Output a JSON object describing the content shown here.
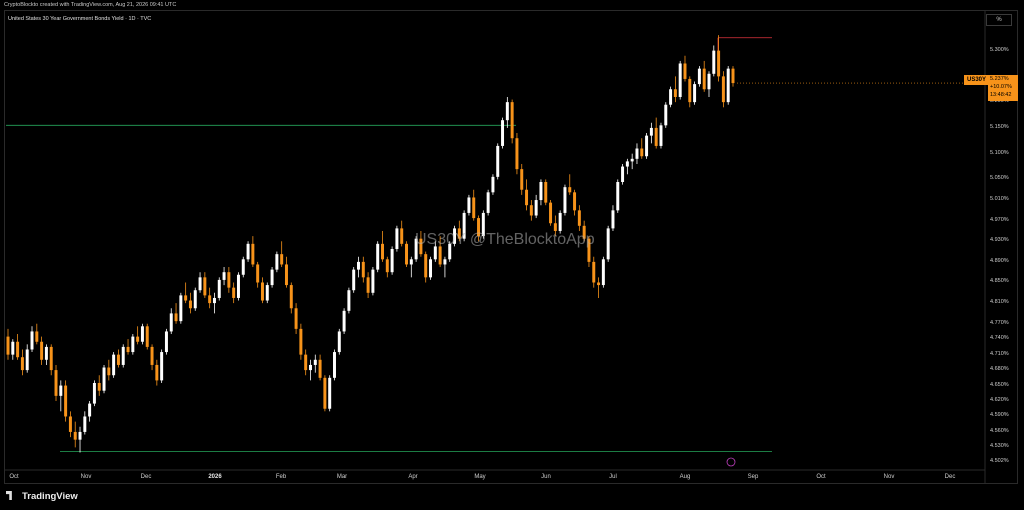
{
  "header": {
    "credit": "CryptoBlockto created with TradingView.com, Aug 21, 2026 09:41 UTC",
    "title": "United States 30 Year Government Bonds Yield · 1D · TVC",
    "scale_button": "%"
  },
  "watermark": "US30Y @TheBlocktoApp",
  "footer": {
    "brand": "TradingView"
  },
  "current": {
    "symbol": "US30Y",
    "price": "5.237%",
    "change": "+10.07%",
    "countdown": "13:48:42"
  },
  "colors": {
    "background": "#000000",
    "up": "#ffffff",
    "down": "#f7931a",
    "resistance": "#e0333c",
    "support": "#26a65b",
    "accent": "#f7931a"
  },
  "chart_data": {
    "type": "candlestick",
    "title": "United States 30 Year Government Bonds Yield · 1D · TVC",
    "y_axis": {
      "ticks": [
        "5.300%",
        "5.250%",
        "5.200%",
        "5.150%",
        "5.100%",
        "5.050%",
        "5.010%",
        "4.970%",
        "4.930%",
        "4.890%",
        "4.850%",
        "4.810%",
        "4.770%",
        "4.740%",
        "4.710%",
        "4.680%",
        "4.650%",
        "4.620%",
        "4.590%",
        "4.560%",
        "4.530%",
        "4.502%"
      ],
      "range": [
        4.49,
        5.34
      ]
    },
    "x_axis": {
      "ticks": [
        "Oct",
        "Nov",
        "Dec",
        "2026",
        "Feb",
        "Mar",
        "Apr",
        "May",
        "Jun",
        "Jul",
        "Aug",
        "Sep",
        "Oct",
        "Nov",
        "Dec"
      ],
      "bold": [
        "2026"
      ]
    },
    "levels": [
      {
        "price": 5.155,
        "color": "support"
      },
      {
        "price": 4.522,
        "color": "support"
      },
      {
        "price": 5.325,
        "color": "resistance"
      }
    ],
    "candles_ohlc": [
      [
        4.745,
        4.76,
        4.7,
        4.71
      ],
      [
        4.71,
        4.74,
        4.7,
        4.735
      ],
      [
        4.735,
        4.75,
        4.7,
        4.705
      ],
      [
        4.705,
        4.72,
        4.67,
        4.68
      ],
      [
        4.68,
        4.73,
        4.675,
        4.72
      ],
      [
        4.72,
        4.765,
        4.715,
        4.755
      ],
      [
        4.755,
        4.77,
        4.73,
        4.735
      ],
      [
        4.735,
        4.745,
        4.69,
        4.7
      ],
      [
        4.7,
        4.73,
        4.69,
        4.725
      ],
      [
        4.725,
        4.73,
        4.67,
        4.68
      ],
      [
        4.68,
        4.69,
        4.62,
        4.63
      ],
      [
        4.63,
        4.66,
        4.6,
        4.65
      ],
      [
        4.65,
        4.66,
        4.58,
        4.59
      ],
      [
        4.59,
        4.6,
        4.55,
        4.56
      ],
      [
        4.56,
        4.58,
        4.53,
        4.545
      ],
      [
        4.545,
        4.57,
        4.52,
        4.56
      ],
      [
        4.56,
        4.6,
        4.555,
        4.59
      ],
      [
        4.59,
        4.62,
        4.58,
        4.615
      ],
      [
        4.615,
        4.66,
        4.61,
        4.655
      ],
      [
        4.655,
        4.67,
        4.63,
        4.64
      ],
      [
        4.64,
        4.69,
        4.635,
        4.685
      ],
      [
        4.685,
        4.7,
        4.66,
        4.67
      ],
      [
        4.67,
        4.715,
        4.665,
        4.71
      ],
      [
        4.71,
        4.72,
        4.685,
        4.69
      ],
      [
        4.69,
        4.73,
        4.685,
        4.725
      ],
      [
        4.725,
        4.74,
        4.71,
        4.715
      ],
      [
        4.715,
        4.75,
        4.71,
        4.745
      ],
      [
        4.745,
        4.765,
        4.73,
        4.735
      ],
      [
        4.735,
        4.77,
        4.73,
        4.765
      ],
      [
        4.765,
        4.77,
        4.72,
        4.725
      ],
      [
        4.725,
        4.73,
        4.68,
        4.69
      ],
      [
        4.69,
        4.7,
        4.65,
        4.66
      ],
      [
        4.66,
        4.72,
        4.655,
        4.715
      ],
      [
        4.715,
        4.76,
        4.71,
        4.755
      ],
      [
        4.755,
        4.8,
        4.75,
        4.79
      ],
      [
        4.79,
        4.81,
        4.77,
        4.775
      ],
      [
        4.775,
        4.83,
        4.77,
        4.825
      ],
      [
        4.825,
        4.85,
        4.81,
        4.815
      ],
      [
        4.815,
        4.83,
        4.79,
        4.8
      ],
      [
        4.8,
        4.84,
        4.795,
        4.835
      ],
      [
        4.835,
        4.87,
        4.83,
        4.86
      ],
      [
        4.86,
        4.87,
        4.82,
        4.825
      ],
      [
        4.825,
        4.84,
        4.8,
        4.81
      ],
      [
        4.81,
        4.83,
        4.79,
        4.82
      ],
      [
        4.82,
        4.86,
        4.815,
        4.855
      ],
      [
        4.855,
        4.88,
        4.845,
        4.87
      ],
      [
        4.87,
        4.88,
        4.83,
        4.84
      ],
      [
        4.84,
        4.85,
        4.81,
        4.82
      ],
      [
        4.82,
        4.87,
        4.815,
        4.865
      ],
      [
        4.865,
        4.9,
        4.86,
        4.895
      ],
      [
        4.895,
        4.93,
        4.89,
        4.925
      ],
      [
        4.925,
        4.94,
        4.88,
        4.885
      ],
      [
        4.885,
        4.89,
        4.84,
        4.85
      ],
      [
        4.85,
        4.86,
        4.81,
        4.815
      ],
      [
        4.815,
        4.85,
        4.81,
        4.845
      ],
      [
        4.845,
        4.88,
        4.84,
        4.875
      ],
      [
        4.875,
        4.91,
        4.87,
        4.905
      ],
      [
        4.905,
        4.93,
        4.88,
        4.885
      ],
      [
        4.885,
        4.9,
        4.84,
        4.845
      ],
      [
        4.845,
        4.85,
        4.79,
        4.8
      ],
      [
        4.8,
        4.81,
        4.75,
        4.76
      ],
      [
        4.76,
        4.77,
        4.7,
        4.71
      ],
      [
        4.71,
        4.72,
        4.67,
        4.68
      ],
      [
        4.68,
        4.7,
        4.66,
        4.69
      ],
      [
        4.69,
        4.71,
        4.675,
        4.7
      ],
      [
        4.7,
        4.71,
        4.66,
        4.665
      ],
      [
        4.665,
        4.67,
        4.6,
        4.605
      ],
      [
        4.605,
        4.67,
        4.6,
        4.665
      ],
      [
        4.665,
        4.72,
        4.66,
        4.715
      ],
      [
        4.715,
        4.76,
        4.71,
        4.755
      ],
      [
        4.755,
        4.8,
        4.75,
        4.795
      ],
      [
        4.795,
        4.84,
        4.79,
        4.835
      ],
      [
        4.835,
        4.88,
        4.83,
        4.875
      ],
      [
        4.875,
        4.9,
        4.86,
        4.89
      ],
      [
        4.89,
        4.9,
        4.85,
        4.86
      ],
      [
        4.86,
        4.87,
        4.82,
        4.83
      ],
      [
        4.83,
        4.88,
        4.825,
        4.875
      ],
      [
        4.875,
        4.93,
        4.87,
        4.925
      ],
      [
        4.925,
        4.95,
        4.89,
        4.895
      ],
      [
        4.895,
        4.9,
        4.86,
        4.87
      ],
      [
        4.87,
        4.92,
        4.865,
        4.915
      ],
      [
        4.915,
        4.96,
        4.91,
        4.955
      ],
      [
        4.955,
        4.97,
        4.92,
        4.925
      ],
      [
        4.925,
        4.93,
        4.88,
        4.885
      ],
      [
        4.885,
        4.9,
        4.86,
        4.895
      ],
      [
        4.895,
        4.94,
        4.89,
        4.935
      ],
      [
        4.935,
        4.95,
        4.9,
        4.905
      ],
      [
        4.905,
        4.91,
        4.85,
        4.86
      ],
      [
        4.86,
        4.9,
        4.855,
        4.895
      ],
      [
        4.895,
        4.93,
        4.89,
        4.92
      ],
      [
        4.92,
        4.94,
        4.88,
        4.885
      ],
      [
        4.885,
        4.9,
        4.86,
        4.895
      ],
      [
        4.895,
        4.93,
        4.89,
        4.925
      ],
      [
        4.925,
        4.96,
        4.92,
        4.955
      ],
      [
        4.955,
        4.97,
        4.93,
        4.935
      ],
      [
        4.935,
        4.99,
        4.93,
        4.985
      ],
      [
        4.985,
        5.02,
        4.98,
        5.015
      ],
      [
        5.015,
        5.03,
        4.97,
        4.975
      ],
      [
        4.975,
        4.98,
        4.93,
        4.94
      ],
      [
        4.94,
        4.99,
        4.935,
        4.985
      ],
      [
        4.985,
        5.03,
        4.98,
        5.025
      ],
      [
        5.025,
        5.06,
        5.02,
        5.055
      ],
      [
        5.055,
        5.12,
        5.05,
        5.115
      ],
      [
        5.115,
        5.17,
        5.11,
        5.165
      ],
      [
        5.165,
        5.21,
        5.15,
        5.2
      ],
      [
        5.2,
        5.205,
        5.12,
        5.13
      ],
      [
        5.13,
        5.14,
        5.06,
        5.07
      ],
      [
        5.07,
        5.08,
        5.02,
        5.03
      ],
      [
        5.03,
        5.05,
        4.99,
        5.0
      ],
      [
        5.0,
        5.01,
        4.97,
        4.98
      ],
      [
        4.98,
        5.02,
        4.975,
        5.01
      ],
      [
        5.01,
        5.05,
        5.0,
        5.045
      ],
      [
        5.045,
        5.05,
        5.0,
        5.005
      ],
      [
        5.005,
        5.01,
        4.96,
        4.965
      ],
      [
        4.965,
        4.98,
        4.94,
        4.95
      ],
      [
        4.95,
        4.99,
        4.945,
        4.985
      ],
      [
        4.985,
        5.04,
        4.98,
        5.035
      ],
      [
        5.035,
        5.06,
        5.02,
        5.025
      ],
      [
        5.025,
        5.03,
        4.98,
        4.99
      ],
      [
        4.99,
        5.0,
        4.95,
        4.96
      ],
      [
        4.96,
        4.97,
        4.93,
        4.935
      ],
      [
        4.935,
        4.94,
        4.88,
        4.89
      ],
      [
        4.89,
        4.9,
        4.84,
        4.85
      ],
      [
        4.85,
        4.86,
        4.82,
        4.845
      ],
      [
        4.845,
        4.9,
        4.84,
        4.895
      ],
      [
        4.895,
        4.96,
        4.89,
        4.955
      ],
      [
        4.955,
        5.0,
        4.95,
        4.99
      ],
      [
        4.99,
        5.05,
        4.985,
        5.045
      ],
      [
        5.045,
        5.08,
        5.04,
        5.075
      ],
      [
        5.075,
        5.09,
        5.06,
        5.085
      ],
      [
        5.085,
        5.1,
        5.07,
        5.09
      ],
      [
        5.09,
        5.12,
        5.08,
        5.11
      ],
      [
        5.11,
        5.13,
        5.09,
        5.095
      ],
      [
        5.095,
        5.14,
        5.09,
        5.135
      ],
      [
        5.135,
        5.16,
        5.12,
        5.15
      ],
      [
        5.15,
        5.17,
        5.11,
        5.115
      ],
      [
        5.115,
        5.16,
        5.11,
        5.155
      ],
      [
        5.155,
        5.2,
        5.15,
        5.195
      ],
      [
        5.195,
        5.23,
        5.19,
        5.225
      ],
      [
        5.225,
        5.25,
        5.2,
        5.21
      ],
      [
        5.21,
        5.28,
        5.205,
        5.275
      ],
      [
        5.275,
        5.29,
        5.24,
        5.245
      ],
      [
        5.245,
        5.25,
        5.19,
        5.2
      ],
      [
        5.2,
        5.24,
        5.195,
        5.235
      ],
      [
        5.235,
        5.27,
        5.23,
        5.265
      ],
      [
        5.265,
        5.28,
        5.22,
        5.225
      ],
      [
        5.225,
        5.26,
        5.21,
        5.255
      ],
      [
        5.255,
        5.31,
        5.25,
        5.3
      ],
      [
        5.3,
        5.33,
        5.24,
        5.25
      ],
      [
        5.25,
        5.26,
        5.19,
        5.2
      ],
      [
        5.2,
        5.27,
        5.195,
        5.265
      ],
      [
        5.265,
        5.27,
        5.23,
        5.237
      ]
    ],
    "ohlc_fields": [
      "open",
      "high",
      "low",
      "close"
    ]
  }
}
